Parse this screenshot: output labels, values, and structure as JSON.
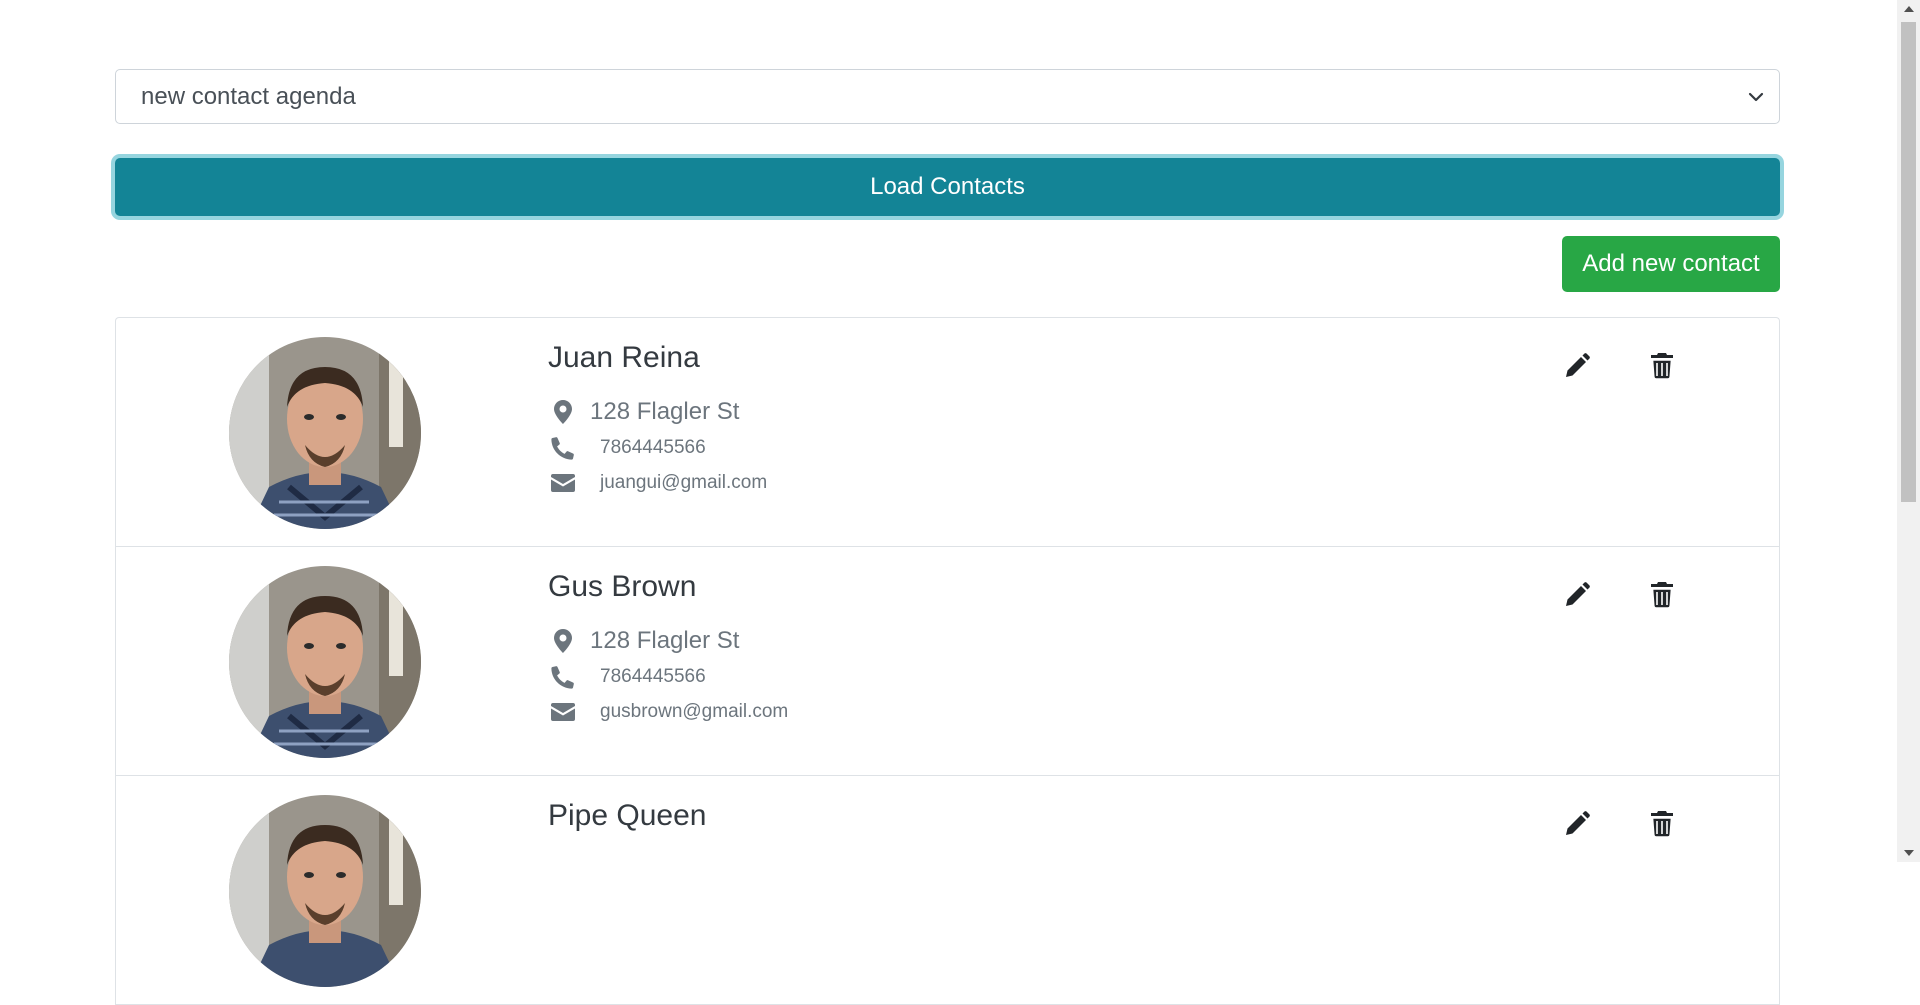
{
  "agenda_select": {
    "value": "new contact agenda"
  },
  "load_button": {
    "label": "Load Contacts"
  },
  "add_button": {
    "label": "Add new contact"
  },
  "colors": {
    "load": "#138496",
    "add": "#28a745",
    "muted": "#6c757d"
  },
  "contacts": [
    {
      "name": "Juan Reina",
      "address": "128 Flagler St",
      "phone": "7864445566",
      "email": "juangui@gmail.com"
    },
    {
      "name": "Gus Brown",
      "address": "128 Flagler St",
      "phone": "7864445566",
      "email": "gusbrown@gmail.com"
    },
    {
      "name": "Pipe Queen"
    }
  ],
  "icons": [
    "map-marker-icon",
    "phone-icon",
    "envelope-icon",
    "pencil-icon",
    "trash-icon",
    "chevron-down-icon"
  ]
}
